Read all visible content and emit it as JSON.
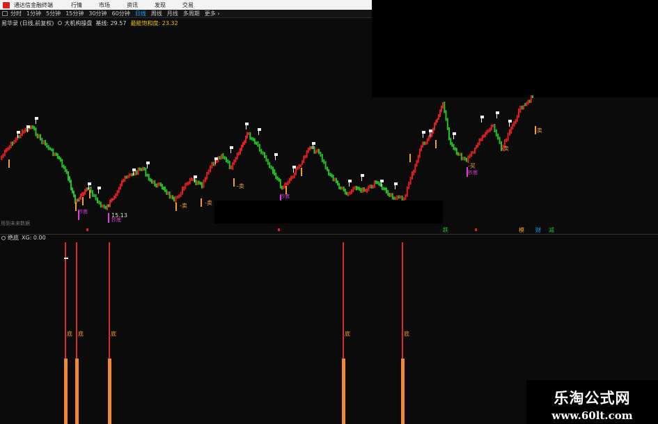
{
  "menubar": {
    "app_title": "通达信金融终端",
    "items": [
      "行情",
      "市场",
      "资讯",
      "发现",
      "交易"
    ]
  },
  "periodbar": {
    "periods": [
      "分时",
      "1分钟",
      "5分钟",
      "15分钟",
      "30分钟",
      "60分钟",
      "日线",
      "周线",
      "月线",
      "多周期",
      "更多 ›"
    ],
    "active": "日线"
  },
  "indicator": {
    "title": "易华录 (日线,前复权)",
    "name": "大机构操盘",
    "value1": "基线: 29.57",
    "value2": "最能饱和度: 23.32"
  },
  "main_chart": {
    "future_label": "用到未来数据",
    "low_price_label": "15.13",
    "buy_label": "买",
    "sell_label": "卖",
    "bottom_label": "抄底",
    "bottom_markers": [
      "跌",
      "模",
      "财",
      "减"
    ]
  },
  "lower_panel": {
    "name": "绝底",
    "value": "XG: 0.00",
    "bar_label": "底"
  },
  "watermark": {
    "cn": "乐淘公式网",
    "url": "www.60lt.com"
  },
  "colors": {
    "up": "#e02020",
    "down": "#22c322",
    "signal_orange": "#f0a030",
    "signal_magenta": "#e040e0",
    "accent": "#1aa3ff"
  }
}
